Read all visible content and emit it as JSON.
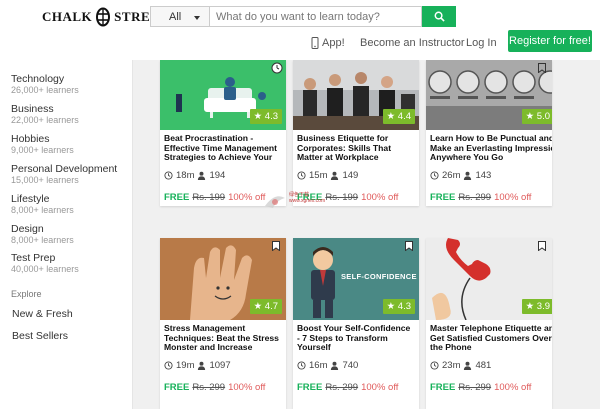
{
  "brand": {
    "left": "CHALK",
    "right": "STREET"
  },
  "search": {
    "category": "All",
    "placeholder": "What do you want to learn today?"
  },
  "nav": {
    "app": "App!",
    "instructor": "Become an Instructor",
    "login": "Log In",
    "register": "Register for free!"
  },
  "sidebar": {
    "categories": [
      {
        "name": "Technology",
        "count": "26,000+ learners"
      },
      {
        "name": "Business",
        "count": "22,000+ learners"
      },
      {
        "name": "Hobbies",
        "count": "9,000+ learners"
      },
      {
        "name": "Personal Development",
        "count": "15,000+ learners"
      },
      {
        "name": "Lifestyle",
        "count": "8,000+ learners"
      },
      {
        "name": "Design",
        "count": "8,000+ learners"
      },
      {
        "name": "Test Prep",
        "count": "40,000+ learners"
      }
    ],
    "explore_label": "Explore",
    "links": [
      "New & Fresh",
      "Best Sellers"
    ]
  },
  "courses": [
    {
      "title": "Beat Procrastination - Effective Time Management Strategies to Achieve Your",
      "rating": "4.3",
      "duration": "18m",
      "learners": "194",
      "free": "FREE",
      "original": "Rs. 199",
      "off": "100% off"
    },
    {
      "title": "Business Etiquette for Corporates: Skills That Matter at Workplace",
      "rating": "4.4",
      "duration": "15m",
      "learners": "149",
      "free": "FREE",
      "original": "Rs. 199",
      "off": "100% off"
    },
    {
      "title": "Learn How to Be Punctual and Make an Everlasting Impression Anywhere You Go",
      "rating": "5.0",
      "duration": "26m",
      "learners": "143",
      "free": "FREE",
      "original": "Rs. 299",
      "off": "100% off"
    },
    {
      "title": "Stress Management Techniques: Beat the Stress Monster and Increase",
      "rating": "4.7",
      "duration": "19m",
      "learners": "1097",
      "free": "FREE",
      "original": "Rs. 299",
      "off": "100% off"
    },
    {
      "title": "Boost Your Self-Confidence - 7 Steps to Transform Yourself",
      "rating": "4.3",
      "duration": "16m",
      "learners": "740",
      "free": "FREE",
      "original": "Rs. 299",
      "off": "100% off"
    },
    {
      "title": "Master Telephone Etiquette and Get Satisfied Customers Over the Phone",
      "rating": "3.9",
      "duration": "23m",
      "learners": "481",
      "free": "FREE",
      "original": "Rs. 299",
      "off": "100% off"
    }
  ],
  "thumb_text": {
    "self_confidence": "SELF-CONFIDENCE"
  },
  "watermark": {
    "line1": "绿色下载",
    "line2": "www.xgnex.com"
  },
  "colors": {
    "accent": "#17b15a",
    "rating": "#7dbb2b",
    "discount": "#e05b5b"
  }
}
